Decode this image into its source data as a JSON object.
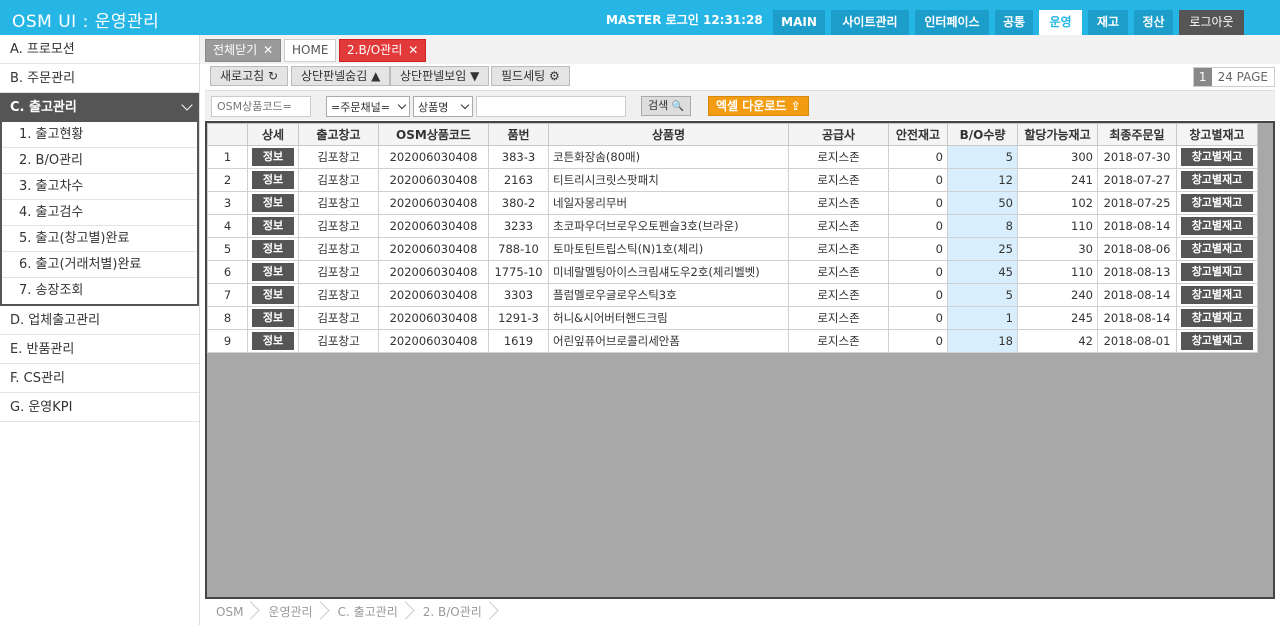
{
  "header": {
    "title": "OSM UI : 운영관리",
    "login_info": "MASTER 로그인 12:31:28",
    "nav": [
      {
        "label": "MAIN",
        "active": false
      },
      {
        "label": "사이트관리",
        "active": false
      },
      {
        "label": "인터페이스",
        "active": false
      },
      {
        "label": "공통",
        "active": false
      },
      {
        "label": "운영",
        "active": true
      },
      {
        "label": "재고",
        "active": false
      },
      {
        "label": "정산",
        "active": false
      },
      {
        "label": "로그아웃",
        "active": false
      }
    ]
  },
  "sidebar": {
    "items_top": [
      "A. 프로모션",
      "B. 주문관리"
    ],
    "active": "C. 출고관리",
    "sub_items": [
      "1. 출고현황",
      "2. B/O관리",
      "3. 출고차수",
      "4. 출고검수",
      "5. 출고(창고별)완료",
      "6. 출고(거래처별)완료",
      "7. 송장조회"
    ],
    "items_bottom": [
      "D. 업체출고관리",
      "E. 반품관리",
      "F. CS관리",
      "G. 운영KPI"
    ]
  },
  "tabs": {
    "close_all": "전체닫기",
    "home": "HOME",
    "current": "2.B/O관리",
    "close_glyph": "✕"
  },
  "toolbar": {
    "refresh": "새로고침",
    "refresh_icon": "↻",
    "hide_panel": "상단판넬숨김",
    "hide_icon": "▲",
    "show_panel": "상단판넬보임",
    "show_icon": "▼",
    "field_setting": "필드세팅",
    "field_icon": "⚙",
    "page_current": "1",
    "page_total": "24 PAGE"
  },
  "search": {
    "code_placeholder": "OSM상품코드=",
    "channel_select": "=주문채널=",
    "field_select": "상품명",
    "keyword_value": "",
    "search_button": "검색",
    "search_icon": "🔍",
    "excel_button": "엑셀 다운로드",
    "excel_icon": "⇪"
  },
  "table": {
    "headers": [
      "",
      "상세",
      "출고창고",
      "OSM상품코드",
      "품번",
      "상품명",
      "공급사",
      "안전재고",
      "B/O수량",
      "할당가능재고",
      "최종주문일",
      "창고별재고"
    ],
    "info_label": "정보",
    "warehouse_label": "창고별재고",
    "rows": [
      {
        "no": "1",
        "wh": "김포창고",
        "code": "202006030408",
        "part": "383-3",
        "name": "코튼화장솜(80매)",
        "supplier": "로지스존",
        "safety": "0",
        "bo": "5",
        "avail": "300",
        "date": "2018-07-30"
      },
      {
        "no": "2",
        "wh": "김포창고",
        "code": "202006030408",
        "part": "2163",
        "name": "티트리시크릿스팟패치",
        "supplier": "로지스존",
        "safety": "0",
        "bo": "12",
        "avail": "241",
        "date": "2018-07-27"
      },
      {
        "no": "3",
        "wh": "김포창고",
        "code": "202006030408",
        "part": "380-2",
        "name": "네일자몽리무버",
        "supplier": "로지스존",
        "safety": "0",
        "bo": "50",
        "avail": "102",
        "date": "2018-07-25"
      },
      {
        "no": "4",
        "wh": "김포창고",
        "code": "202006030408",
        "part": "3233",
        "name": "초코파우더브로우오토펜슬3호(브라운)",
        "supplier": "로지스존",
        "safety": "0",
        "bo": "8",
        "avail": "110",
        "date": "2018-08-14"
      },
      {
        "no": "5",
        "wh": "김포창고",
        "code": "202006030408",
        "part": "788-10",
        "name": "토마토틴트립스틱(N)1호(체리)",
        "supplier": "로지스존",
        "safety": "0",
        "bo": "25",
        "avail": "30",
        "date": "2018-08-06"
      },
      {
        "no": "6",
        "wh": "김포창고",
        "code": "202006030408",
        "part": "1775-10",
        "name": "미네랄멜팅아이스크림섀도우2호(체리벨벳)",
        "supplier": "로지스존",
        "safety": "0",
        "bo": "45",
        "avail": "110",
        "date": "2018-08-13"
      },
      {
        "no": "7",
        "wh": "김포창고",
        "code": "202006030408",
        "part": "3303",
        "name": "플럼멜로우글로우스틱3호",
        "supplier": "로지스존",
        "safety": "0",
        "bo": "5",
        "avail": "240",
        "date": "2018-08-14"
      },
      {
        "no": "8",
        "wh": "김포창고",
        "code": "202006030408",
        "part": "1291-3",
        "name": "허니&시어버터핸드크림",
        "supplier": "로지스존",
        "safety": "0",
        "bo": "1",
        "avail": "245",
        "date": "2018-08-14"
      },
      {
        "no": "9",
        "wh": "김포창고",
        "code": "202006030408",
        "part": "1619",
        "name": "어린잎퓨어브로콜리세안폼",
        "supplier": "로지스존",
        "safety": "0",
        "bo": "18",
        "avail": "42",
        "date": "2018-08-01"
      }
    ]
  },
  "breadcrumb": [
    "OSM",
    "운영관리",
    "C. 출고관리",
    "2. B/O관리"
  ]
}
